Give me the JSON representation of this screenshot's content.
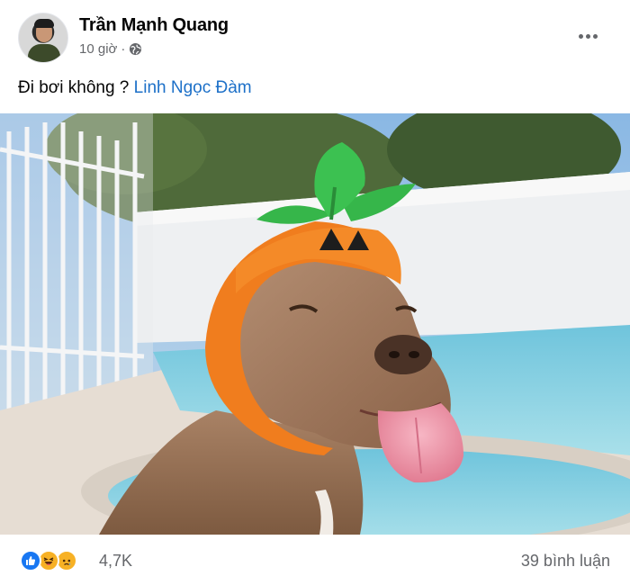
{
  "post": {
    "author": "Trần Mạnh Quang",
    "time": "10 giờ",
    "separator": "·",
    "caption_text": "Đi bơi không ?",
    "mention": "Linh Ngọc Đàm",
    "photo_icon": "dog-in-pumpkin-hat-photo",
    "reactions": {
      "icons": [
        "like-icon",
        "haha-icon",
        "sad-icon"
      ],
      "count": "4,7K"
    },
    "comments": "39 bình luận",
    "colors": {
      "link": "#1d70c8",
      "secondary_text": "#65676b",
      "like": "#1877f2",
      "emoji": "#f7b125"
    }
  }
}
